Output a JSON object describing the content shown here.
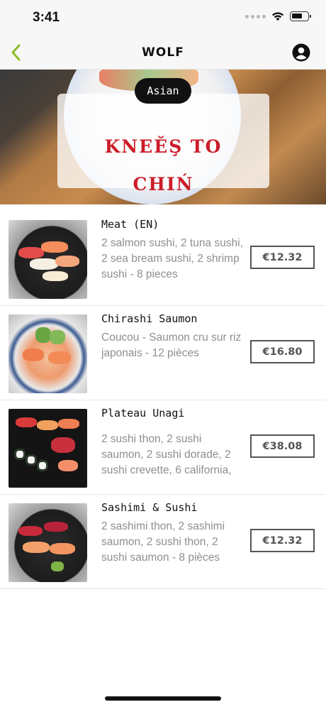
{
  "status_bar": {
    "time": "3:41"
  },
  "nav": {
    "brand": "WOLF"
  },
  "hero": {
    "category": "Asian",
    "logo_line1": "KNEĚŞ TO",
    "logo_line2": "CHIŃ"
  },
  "items": [
    {
      "name": "Meat (EN)",
      "description": "2 salmon sushi, 2 tuna sushi, 2 sea bream sushi, 2 shrimp sushi - 8 pieces",
      "price": "€12.32"
    },
    {
      "name": "Chirashi Saumon",
      "description": "Coucou - Saumon cru sur riz japonais - 12 pièces",
      "price": "€16.80"
    },
    {
      "name": "Plateau Unagi",
      "description": "2 sushi thon, 2 sushi saumon, 2 sushi dorade, 2 sushi crevette, 6 california,",
      "price": "€38.08"
    },
    {
      "name": "Sashimi & Sushi",
      "description": "2 sashimi thon, 2 sashimi saumon, 2 sushi thon, 2 sushi saumon - 8 pièces",
      "price": "€12.32"
    }
  ],
  "colors": {
    "accent_green": "#8dbb2a",
    "logo_red": "#cc1d2a"
  },
  "icons": {
    "back": "chevron-left-icon",
    "profile": "user-circle-icon",
    "wifi": "wifi-icon",
    "battery": "battery-icon"
  }
}
